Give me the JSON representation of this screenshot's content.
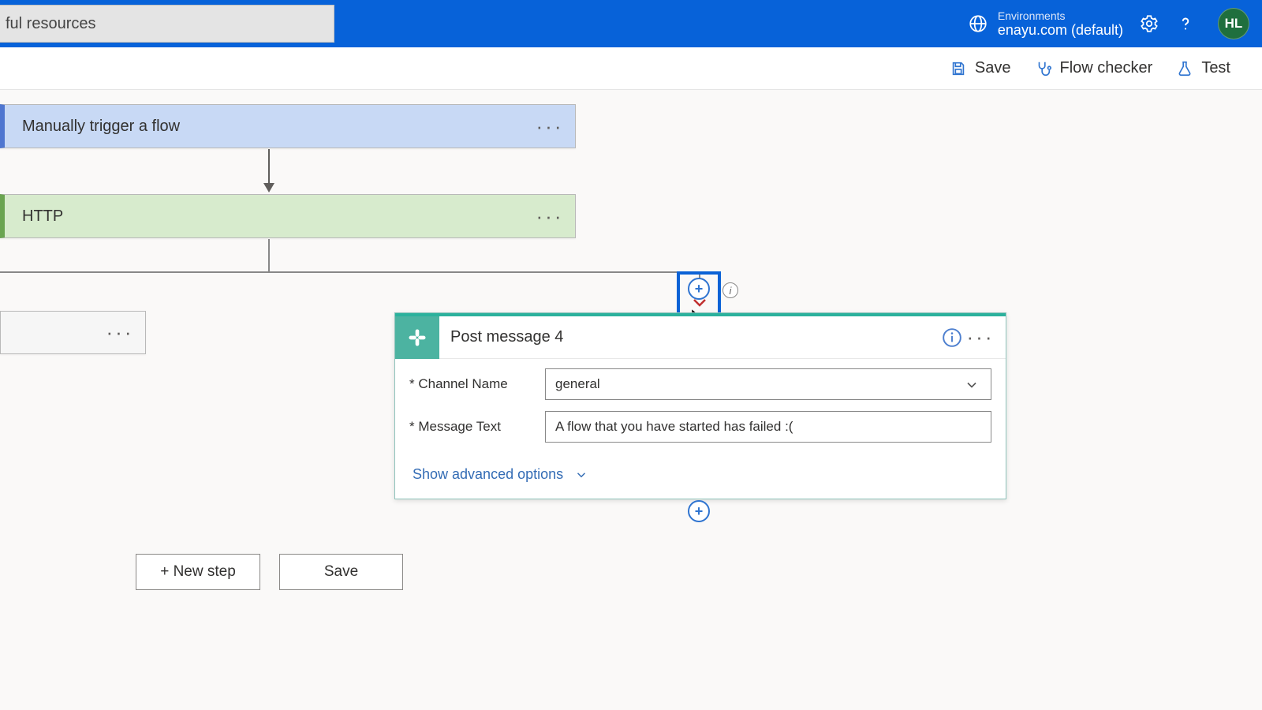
{
  "topbar": {
    "search_text": "ful resources",
    "env_label": "Environments",
    "env_value": "enayu.com (default)",
    "avatar_initials": "HL"
  },
  "cmdbar": {
    "save": "Save",
    "flow_checker": "Flow checker",
    "test": "Test"
  },
  "cards": {
    "trigger": "Manually trigger a flow",
    "http": "HTTP"
  },
  "panel": {
    "title": "Post message 4",
    "fields": {
      "channel_label": "* Channel Name",
      "channel_value": "general",
      "message_label": "* Message Text",
      "message_value": "A flow that you have started has failed :("
    },
    "advanced": "Show advanced options"
  },
  "buttons": {
    "new_step": "+ New step",
    "save": "Save"
  }
}
